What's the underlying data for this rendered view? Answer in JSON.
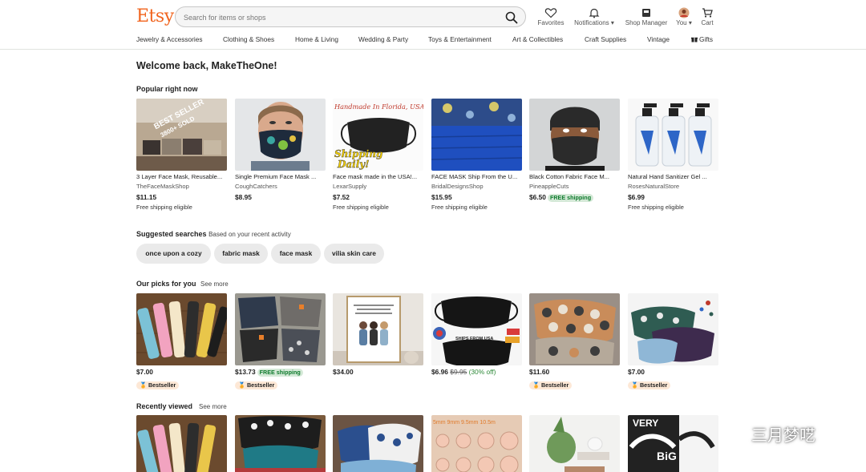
{
  "header": {
    "logo": "Etsy",
    "search_placeholder": "Search for items or shops",
    "nav": {
      "favorites": "Favorites",
      "notifications": "Notifications ▾",
      "shop_manager": "Shop Manager",
      "you": "You ▾",
      "cart": "Cart"
    },
    "categories": [
      "Jewelry & Accessories",
      "Clothing & Shoes",
      "Home & Living",
      "Wedding & Party",
      "Toys & Entertainment",
      "Art & Collectibles",
      "Craft Supplies",
      "Vintage",
      "Gifts"
    ]
  },
  "welcome": "Welcome back, MakeTheOne!",
  "popular": {
    "title": "Popular right now",
    "items": [
      {
        "title": "3 Layer Face Mask, Reusable...",
        "shop": "TheFaceMaskShop",
        "price": "$11.15",
        "ship": "Free shipping eligible",
        "img_text_1": "BEST SELLER",
        "img_text_2": "3800+ SOLD"
      },
      {
        "title": "Single Premium Face Mask ...",
        "shop": "CoughCatchers",
        "price": "$8.95",
        "ship": ""
      },
      {
        "title": "Face mask made in the USA!...",
        "shop": "LexarSupply",
        "price": "$7.52",
        "ship": "Free shipping eligible",
        "img_text_1": "Handmade In Florida, USA",
        "img_text_2": "Shipping",
        "img_text_3": "Daily!"
      },
      {
        "title": "FACE MASK Ship From the U...",
        "shop": "BridalDesignsShop",
        "price": "$15.95",
        "ship": "Free shipping eligible"
      },
      {
        "title": "Black Cotton Fabric Face M...",
        "shop": "PineappleCuts",
        "price": "$6.50",
        "badge": "FREE shipping",
        "ship": ""
      },
      {
        "title": "Natural Hand Sanitizer Gel ...",
        "shop": "RosesNaturalStore",
        "price": "$6.99",
        "ship": "Free shipping eligible"
      }
    ]
  },
  "suggested": {
    "title": "Suggested searches",
    "subtitle": "Based on your recent activity",
    "chips": [
      "once upon a cozy",
      "fabric mask",
      "face mask",
      "vilia skin care"
    ]
  },
  "picks": {
    "title": "Our picks for you",
    "see_more": "See more",
    "items": [
      {
        "price": "$7.00",
        "bestseller": "Bestseller"
      },
      {
        "price": "$13.73",
        "badge": "FREE shipping",
        "bestseller": "Bestseller"
      },
      {
        "price": "$34.00"
      },
      {
        "price": "$6.96",
        "old_price": "$9.95",
        "discount": "(30% off)",
        "img_text": "SHIPS FROM USA"
      },
      {
        "price": "$11.60",
        "bestseller": "Bestseller"
      },
      {
        "price": "$7.00",
        "bestseller": "Bestseller"
      }
    ]
  },
  "recent": {
    "title": "Recently viewed",
    "see_more": "See more",
    "img_text_sizes": "5mm  9mm  9.5mm  10.5m",
    "img_text_very": "VERY",
    "img_text_big": "BiG"
  },
  "watermark": "三月梦呓",
  "colors": {
    "brand": "#f1641e",
    "green_badge": "#d4e9d7",
    "bestseller_badge": "#fde8d6",
    "chip": "#eaeaea"
  }
}
